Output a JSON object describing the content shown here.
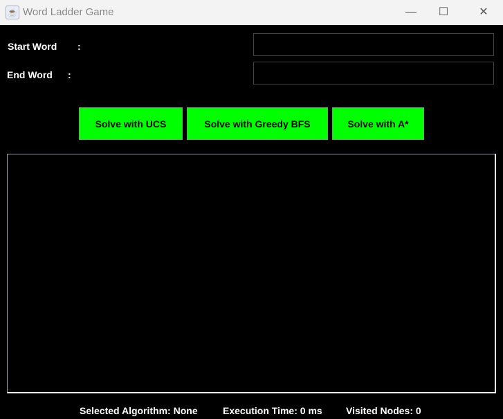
{
  "window": {
    "title": "Word Ladder Game",
    "minimize": "—",
    "maximize": "☐",
    "close": "✕",
    "icon": "java-icon"
  },
  "form": {
    "start_label": "Start Word",
    "start_colon": ":",
    "start_value": "",
    "end_label": "End Word",
    "end_colon": ":",
    "end_value": ""
  },
  "buttons": {
    "ucs": "Solve with UCS",
    "gbfs": "Solve with Greedy BFS",
    "astar": "Solve with A*"
  },
  "colors": {
    "button": "#00ff00",
    "background": "#000000"
  },
  "output": {
    "text": ""
  },
  "status": {
    "algorithm": "Selected Algorithm: None",
    "time": "Execution Time: 0 ms",
    "nodes": "Visited Nodes: 0"
  }
}
